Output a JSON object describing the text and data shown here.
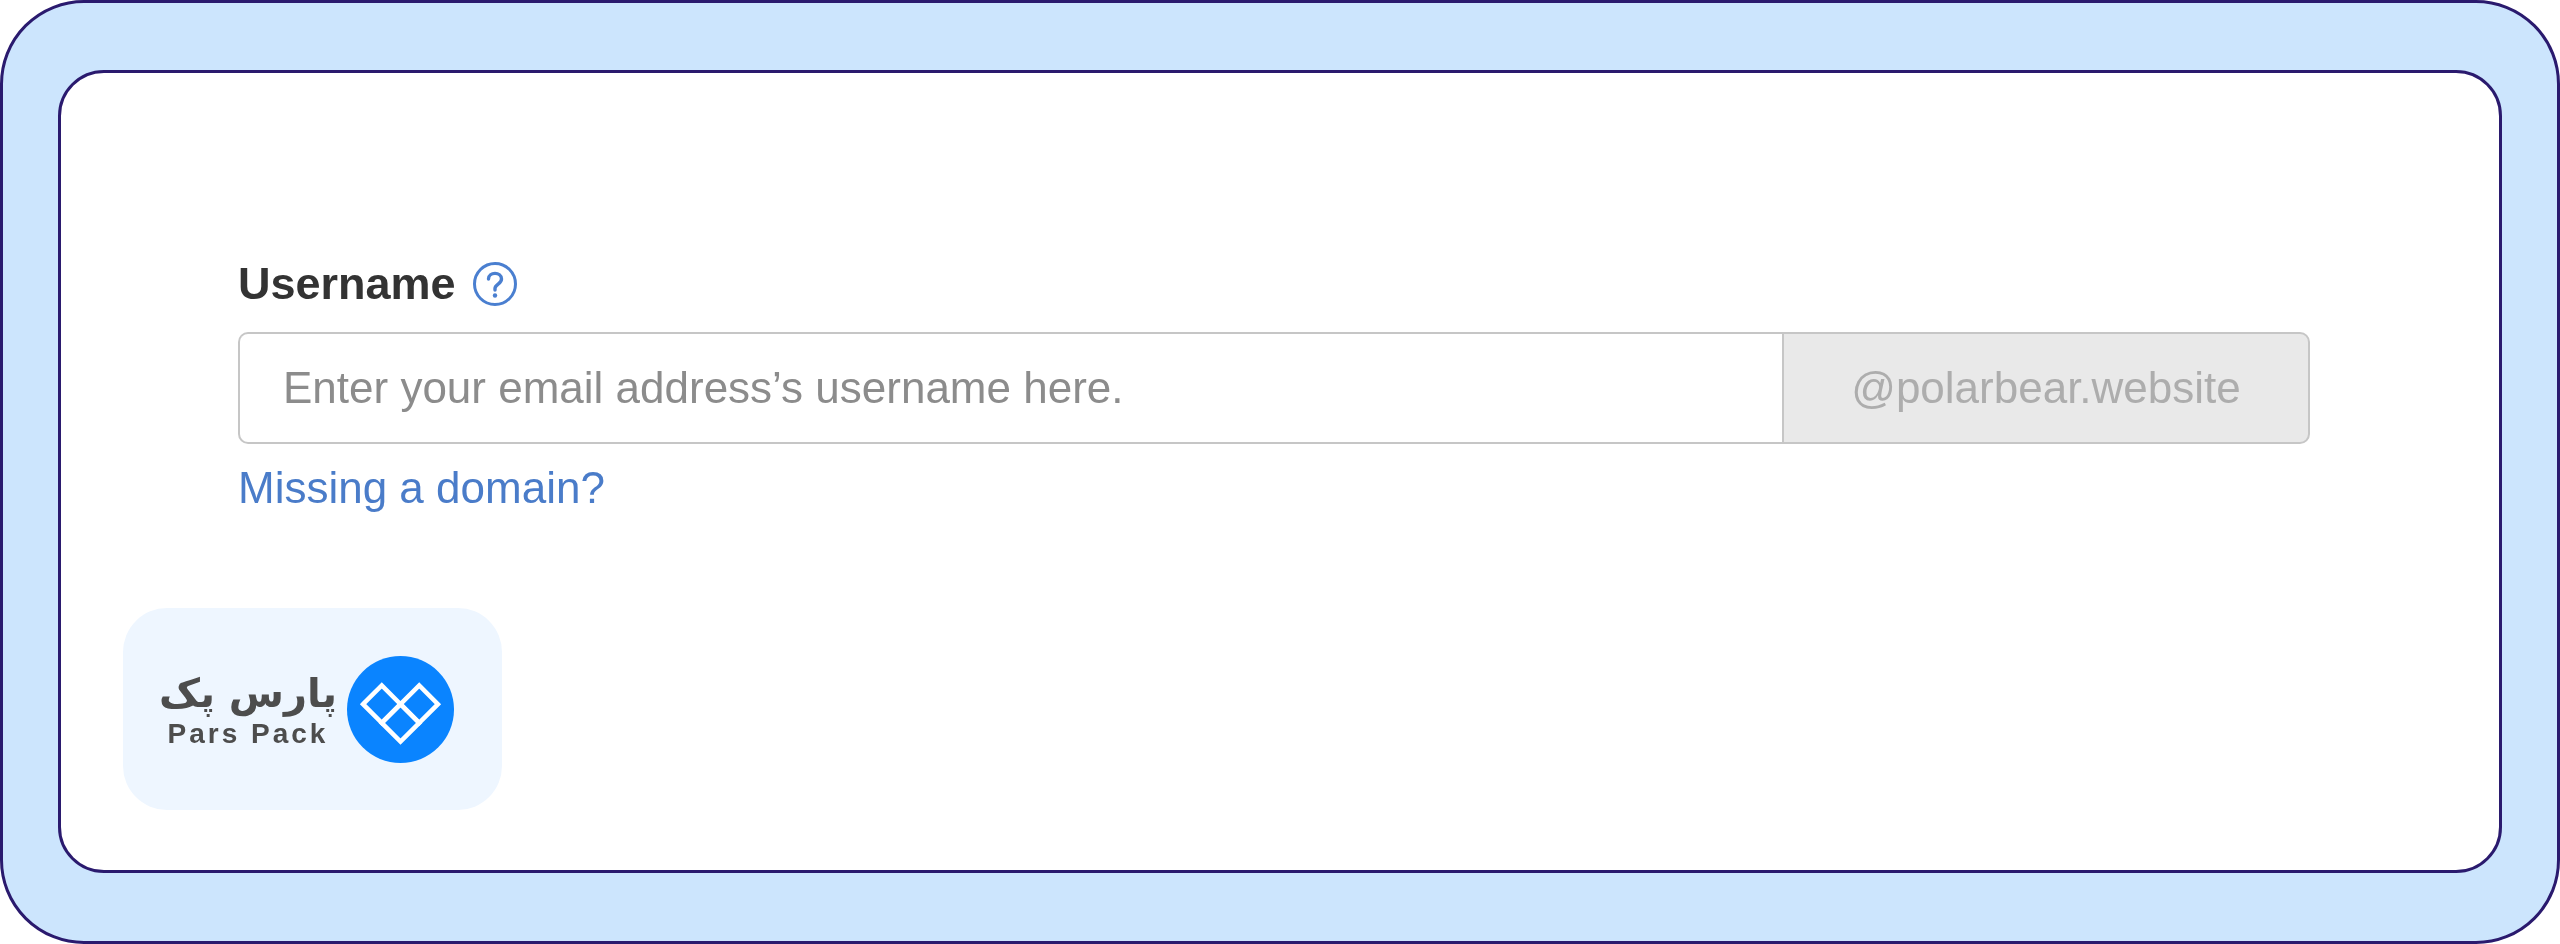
{
  "form": {
    "label": "Username",
    "field": {
      "placeholder": "Enter your email address’s username here.",
      "suffix": "@polarbear.website"
    },
    "link": "Missing a domain?"
  },
  "logo": {
    "name_fa": "پارس پک",
    "name_en": "Pars Pack"
  }
}
